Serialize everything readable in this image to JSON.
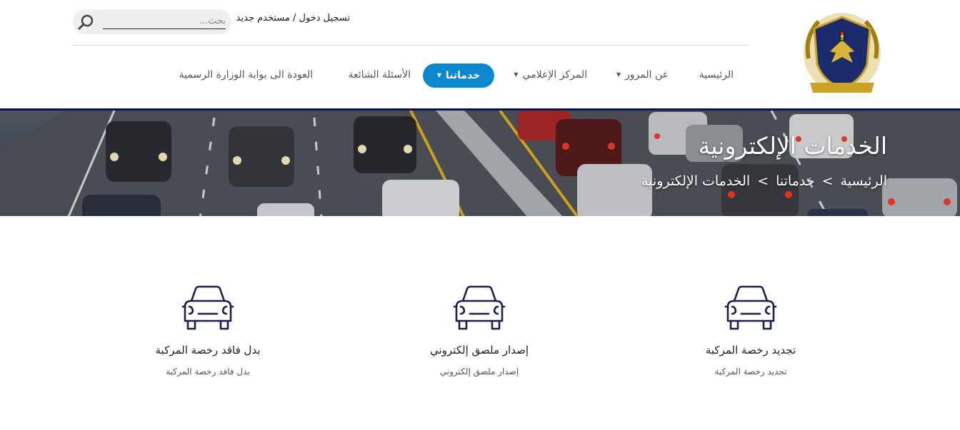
{
  "header": {
    "logo_label": "logo",
    "search_placeholder": "بحث...",
    "login_label": "تسجيل دخول",
    "separator": " / ",
    "register_label": "مستخدم جديد"
  },
  "nav": {
    "items": [
      {
        "label": "الرئيسية",
        "has_dropdown": false,
        "active": false
      },
      {
        "label": "عن المرور",
        "has_dropdown": true,
        "active": false
      },
      {
        "label": "المركز الإعلامي",
        "has_dropdown": true,
        "active": false
      },
      {
        "label": "خدماتنا",
        "has_dropdown": true,
        "active": true
      },
      {
        "label": "الأسئلة الشائعة",
        "has_dropdown": false,
        "active": false
      },
      {
        "label": "العودة الى بوابة الوزارة الرسمية",
        "has_dropdown": false,
        "active": false
      }
    ],
    "caret_glyph": "▼"
  },
  "banner": {
    "title": "الخدمات الإلكترونية",
    "breadcrumb": {
      "home": "الرئيسية",
      "services": "خدماتنا",
      "current": "الخدمات الإلكترونية",
      "separator": ">"
    }
  },
  "services": [
    {
      "title": "تجديد رخصة المركبة",
      "description": "تجديد رخصة المركبة",
      "icon": "car-icon"
    },
    {
      "title": "إصدار ملصق إلكتروني",
      "description": "إصدار ملصق إلكتروني",
      "icon": "car-icon"
    },
    {
      "title": "بدل فاقد رخصة المركبة",
      "description": "بدل فاقد رخصة المركبة",
      "icon": "car-icon"
    }
  ],
  "colors": {
    "accent": "#0d88cf",
    "navy": "#1b1f4a",
    "banner_border": "#0a1550"
  }
}
